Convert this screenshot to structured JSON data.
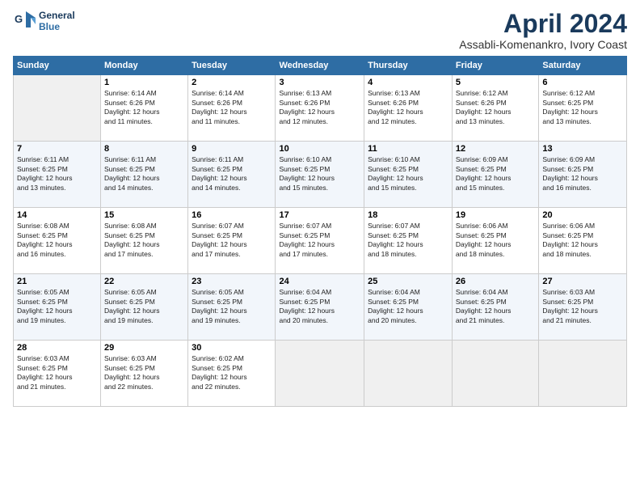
{
  "logo": {
    "line1": "General",
    "line2": "Blue"
  },
  "title": "April 2024",
  "subtitle": "Assabli-Komenankro, Ivory Coast",
  "days_header": [
    "Sunday",
    "Monday",
    "Tuesday",
    "Wednesday",
    "Thursday",
    "Friday",
    "Saturday"
  ],
  "weeks": [
    [
      {
        "day": "",
        "info": ""
      },
      {
        "day": "1",
        "info": "Sunrise: 6:14 AM\nSunset: 6:26 PM\nDaylight: 12 hours\nand 11 minutes."
      },
      {
        "day": "2",
        "info": "Sunrise: 6:14 AM\nSunset: 6:26 PM\nDaylight: 12 hours\nand 11 minutes."
      },
      {
        "day": "3",
        "info": "Sunrise: 6:13 AM\nSunset: 6:26 PM\nDaylight: 12 hours\nand 12 minutes."
      },
      {
        "day": "4",
        "info": "Sunrise: 6:13 AM\nSunset: 6:26 PM\nDaylight: 12 hours\nand 12 minutes."
      },
      {
        "day": "5",
        "info": "Sunrise: 6:12 AM\nSunset: 6:26 PM\nDaylight: 12 hours\nand 13 minutes."
      },
      {
        "day": "6",
        "info": "Sunrise: 6:12 AM\nSunset: 6:25 PM\nDaylight: 12 hours\nand 13 minutes."
      }
    ],
    [
      {
        "day": "7",
        "info": "Sunrise: 6:11 AM\nSunset: 6:25 PM\nDaylight: 12 hours\nand 13 minutes."
      },
      {
        "day": "8",
        "info": "Sunrise: 6:11 AM\nSunset: 6:25 PM\nDaylight: 12 hours\nand 14 minutes."
      },
      {
        "day": "9",
        "info": "Sunrise: 6:11 AM\nSunset: 6:25 PM\nDaylight: 12 hours\nand 14 minutes."
      },
      {
        "day": "10",
        "info": "Sunrise: 6:10 AM\nSunset: 6:25 PM\nDaylight: 12 hours\nand 15 minutes."
      },
      {
        "day": "11",
        "info": "Sunrise: 6:10 AM\nSunset: 6:25 PM\nDaylight: 12 hours\nand 15 minutes."
      },
      {
        "day": "12",
        "info": "Sunrise: 6:09 AM\nSunset: 6:25 PM\nDaylight: 12 hours\nand 15 minutes."
      },
      {
        "day": "13",
        "info": "Sunrise: 6:09 AM\nSunset: 6:25 PM\nDaylight: 12 hours\nand 16 minutes."
      }
    ],
    [
      {
        "day": "14",
        "info": "Sunrise: 6:08 AM\nSunset: 6:25 PM\nDaylight: 12 hours\nand 16 minutes."
      },
      {
        "day": "15",
        "info": "Sunrise: 6:08 AM\nSunset: 6:25 PM\nDaylight: 12 hours\nand 17 minutes."
      },
      {
        "day": "16",
        "info": "Sunrise: 6:07 AM\nSunset: 6:25 PM\nDaylight: 12 hours\nand 17 minutes."
      },
      {
        "day": "17",
        "info": "Sunrise: 6:07 AM\nSunset: 6:25 PM\nDaylight: 12 hours\nand 17 minutes."
      },
      {
        "day": "18",
        "info": "Sunrise: 6:07 AM\nSunset: 6:25 PM\nDaylight: 12 hours\nand 18 minutes."
      },
      {
        "day": "19",
        "info": "Sunrise: 6:06 AM\nSunset: 6:25 PM\nDaylight: 12 hours\nand 18 minutes."
      },
      {
        "day": "20",
        "info": "Sunrise: 6:06 AM\nSunset: 6:25 PM\nDaylight: 12 hours\nand 18 minutes."
      }
    ],
    [
      {
        "day": "21",
        "info": "Sunrise: 6:05 AM\nSunset: 6:25 PM\nDaylight: 12 hours\nand 19 minutes."
      },
      {
        "day": "22",
        "info": "Sunrise: 6:05 AM\nSunset: 6:25 PM\nDaylight: 12 hours\nand 19 minutes."
      },
      {
        "day": "23",
        "info": "Sunrise: 6:05 AM\nSunset: 6:25 PM\nDaylight: 12 hours\nand 19 minutes."
      },
      {
        "day": "24",
        "info": "Sunrise: 6:04 AM\nSunset: 6:25 PM\nDaylight: 12 hours\nand 20 minutes."
      },
      {
        "day": "25",
        "info": "Sunrise: 6:04 AM\nSunset: 6:25 PM\nDaylight: 12 hours\nand 20 minutes."
      },
      {
        "day": "26",
        "info": "Sunrise: 6:04 AM\nSunset: 6:25 PM\nDaylight: 12 hours\nand 21 minutes."
      },
      {
        "day": "27",
        "info": "Sunrise: 6:03 AM\nSunset: 6:25 PM\nDaylight: 12 hours\nand 21 minutes."
      }
    ],
    [
      {
        "day": "28",
        "info": "Sunrise: 6:03 AM\nSunset: 6:25 PM\nDaylight: 12 hours\nand 21 minutes."
      },
      {
        "day": "29",
        "info": "Sunrise: 6:03 AM\nSunset: 6:25 PM\nDaylight: 12 hours\nand 22 minutes."
      },
      {
        "day": "30",
        "info": "Sunrise: 6:02 AM\nSunset: 6:25 PM\nDaylight: 12 hours\nand 22 minutes."
      },
      {
        "day": "",
        "info": ""
      },
      {
        "day": "",
        "info": ""
      },
      {
        "day": "",
        "info": ""
      },
      {
        "day": "",
        "info": ""
      }
    ]
  ]
}
